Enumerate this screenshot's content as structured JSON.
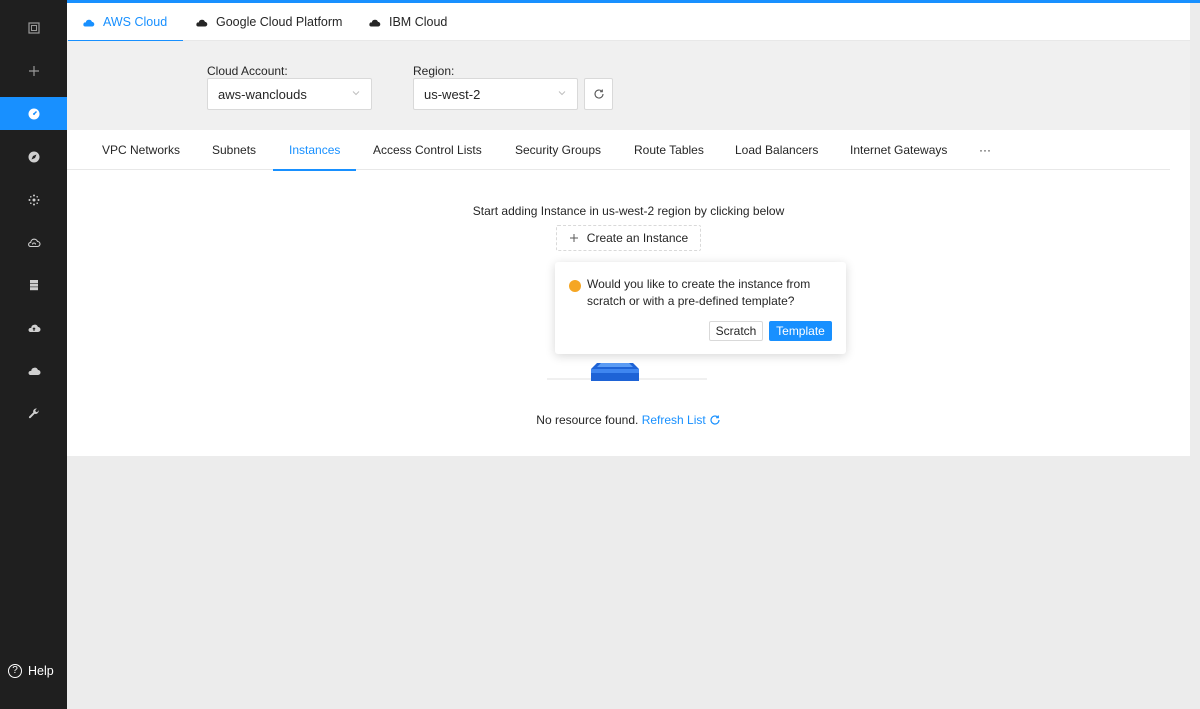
{
  "colors": {
    "accent": "#1890ff",
    "sidebar": "#1f1f1f",
    "warning": "#f5a623"
  },
  "sidebar": {
    "icons": [
      "dashboard-square-icon",
      "plus-icon",
      "gauge-icon",
      "compass-icon",
      "cluster-icon",
      "cloud-sync-icon",
      "database-icon",
      "cloud-upload-icon",
      "cloud-icon",
      "wrench-icon"
    ],
    "active_index": 2,
    "help_label": "Help"
  },
  "cloud_tabs": [
    {
      "label": "AWS Cloud",
      "icon": "cloud-icon",
      "active": true
    },
    {
      "label": "Google Cloud Platform",
      "icon": "cloud-icon",
      "active": false
    },
    {
      "label": "IBM Cloud",
      "icon": "cloud-icon",
      "active": false
    }
  ],
  "filters": {
    "account_label": "Cloud Account:",
    "account_value": "aws-wanclouds",
    "region_label": "Region:",
    "region_value": "us-west-2"
  },
  "resource_tabs": [
    {
      "label": "VPC Networks",
      "active": false
    },
    {
      "label": "Subnets",
      "active": false
    },
    {
      "label": "Instances",
      "active": true
    },
    {
      "label": "Access Control Lists",
      "active": false
    },
    {
      "label": "Security Groups",
      "active": false
    },
    {
      "label": "Route Tables",
      "active": false
    },
    {
      "label": "Load Balancers",
      "active": false
    },
    {
      "label": "Internet Gateways",
      "active": false
    },
    {
      "label": "···",
      "active": false
    }
  ],
  "empty_state": {
    "hint": "Start adding Instance in us-west-2 region by clicking below",
    "create_label": "Create an Instance",
    "no_resource_text": "No resource found.",
    "refresh_link": "Refresh List"
  },
  "popover": {
    "message": "Would you like to create the instance from scratch or with a pre-defined template?",
    "scratch_label": "Scratch",
    "template_label": "Template"
  }
}
